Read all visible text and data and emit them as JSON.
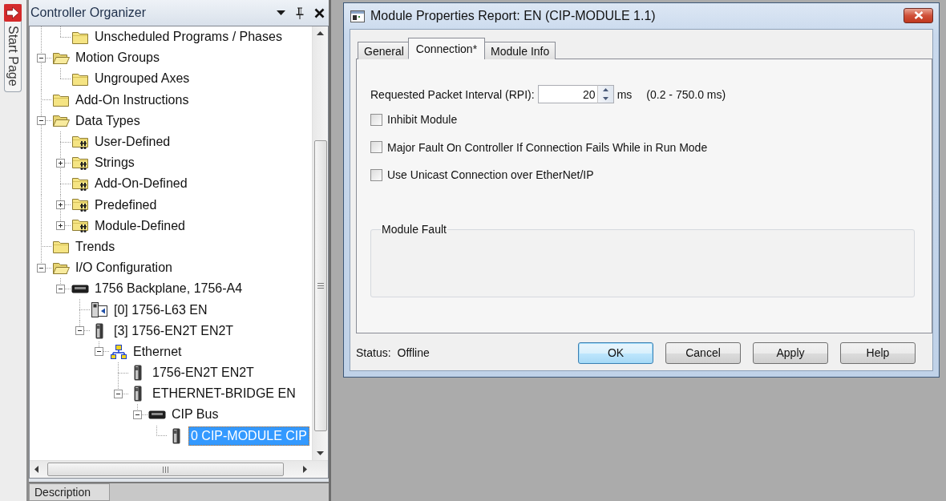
{
  "start_tab": {
    "label": "Start Page"
  },
  "organizer": {
    "title": "Controller Organizer",
    "tree": [
      {
        "children": [
          {
            "label": "Unscheduled Programs / Phases",
            "kind": "folder",
            "selected": false
          }
        ]
      },
      {
        "label": "Motion Groups",
        "kind": "folder",
        "expanded": true,
        "selected": false,
        "children": [
          {
            "label": "Ungrouped Axes",
            "kind": "folder",
            "selected": false
          }
        ]
      },
      {
        "label": "Add-On Instructions",
        "kind": "folder",
        "selected": false
      },
      {
        "label": "Data Types",
        "kind": "folder",
        "expanded": true,
        "selected": false,
        "children": [
          {
            "label": "User-Defined",
            "kind": "type-folder",
            "selected": false
          },
          {
            "label": "Strings",
            "kind": "type-folder",
            "expanded": false,
            "selected": false
          },
          {
            "label": "Add-On-Defined",
            "kind": "type-folder",
            "selected": false
          },
          {
            "label": "Predefined",
            "kind": "type-folder",
            "expanded": false,
            "selected": false
          },
          {
            "label": "Module-Defined",
            "kind": "type-folder",
            "expanded": false,
            "selected": false
          }
        ]
      },
      {
        "label": "Trends",
        "kind": "folder",
        "selected": false
      },
      {
        "label": "I/O Configuration",
        "kind": "folder",
        "expanded": true,
        "selected": false,
        "children": [
          {
            "label": "1756 Backplane, 1756-A4",
            "kind": "chassis",
            "expanded": true,
            "selected": false,
            "children": [
              {
                "label": "[0] 1756-L63 EN",
                "kind": "controller",
                "selected": false
              },
              {
                "label": "[3] 1756-EN2T EN2T",
                "kind": "module",
                "expanded": true,
                "selected": false,
                "children": [
                  {
                    "label": "Ethernet",
                    "kind": "network",
                    "expanded": true,
                    "selected": false,
                    "children": [
                      {
                        "label": "1756-EN2T EN2T",
                        "kind": "module",
                        "selected": false
                      },
                      {
                        "label": "ETHERNET-BRIDGE EN",
                        "kind": "module",
                        "expanded": true,
                        "selected": false,
                        "children": [
                          {
                            "label": "CIP Bus",
                            "kind": "chassis",
                            "expanded": true,
                            "selected": false,
                            "children": [
                              {
                                "label": "0 CIP-MODULE CIP",
                                "kind": "module",
                                "selected": true
                              }
                            ]
                          }
                        ]
                      }
                    ]
                  }
                ]
              }
            ]
          }
        ]
      }
    ],
    "description_label": "Description"
  },
  "dialog": {
    "title": "Module Properties Report: EN (CIP-MODULE 1.1)",
    "tabs": [
      {
        "label": "General",
        "selected": false
      },
      {
        "label": "Connection*",
        "selected": true
      },
      {
        "label": "Module Info",
        "selected": false
      }
    ],
    "rpi": {
      "label": "Requested Packet Interval (RPI):",
      "value": "20",
      "unit": "ms",
      "range": "(0.2 - 750.0 ms)"
    },
    "options": [
      {
        "label": "Inhibit Module",
        "checked": false
      },
      {
        "label": "Major Fault On Controller If Connection Fails While in Run Mode",
        "checked": false
      },
      {
        "label": "Use Unicast Connection over EtherNet/IP",
        "checked": false
      }
    ],
    "fault_group": {
      "title": "Module Fault"
    },
    "status": {
      "label": "Status:",
      "value": "Offline"
    },
    "buttons": [
      {
        "label": "OK",
        "default": true
      },
      {
        "label": "Cancel",
        "default": false
      },
      {
        "label": "Apply",
        "default": false
      },
      {
        "label": "Help",
        "default": false
      }
    ]
  }
}
